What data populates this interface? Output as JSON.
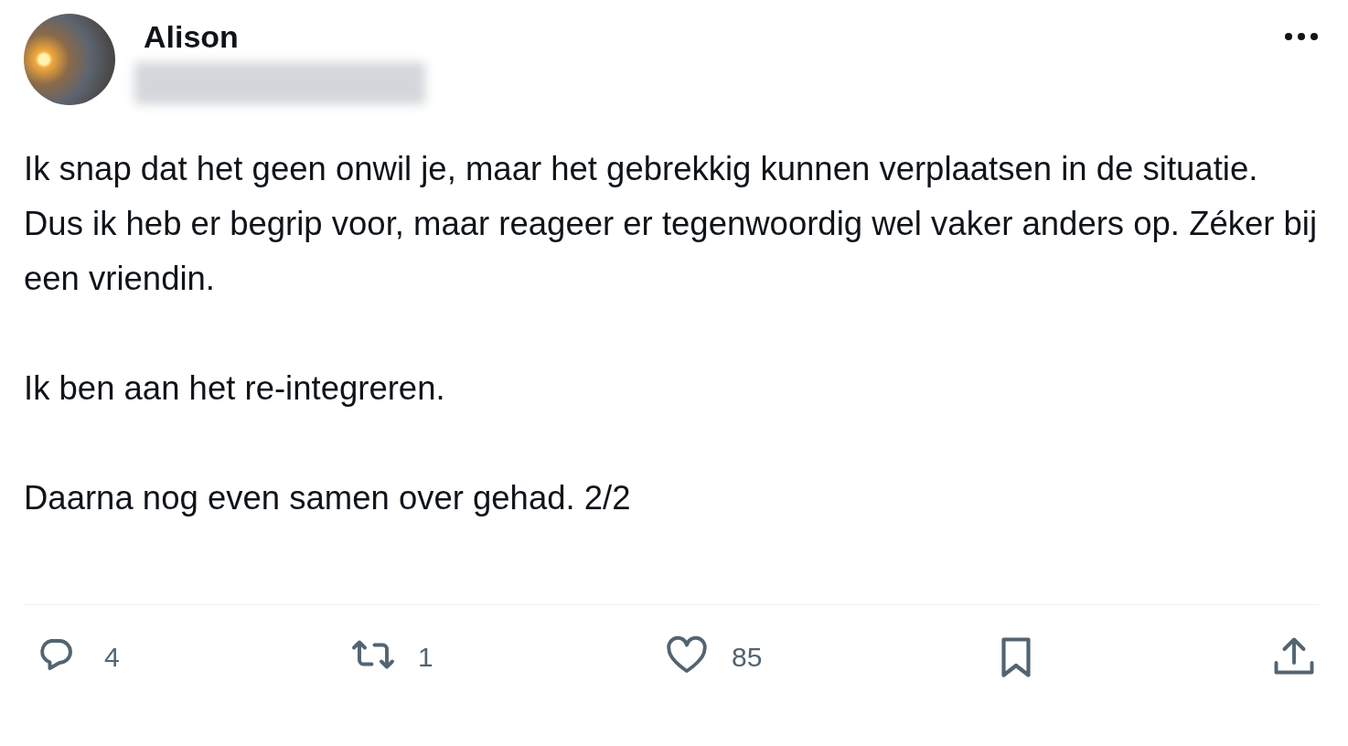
{
  "post": {
    "author": {
      "name": "Alison",
      "handle_redacted": true
    },
    "paragraphs": [
      "Ik snap dat het geen onwil je, maar het gebrekkig kunnen verplaatsen in de situatie. Dus ik heb er begrip voor, maar reageer er tegenwoordig wel vaker anders op. Zéker bij een vriendin.",
      "Ik ben aan het re-integreren.",
      "Daarna nog even samen over gehad. 2/2"
    ],
    "actions": [
      {
        "kind": "reply",
        "count": "4"
      },
      {
        "kind": "repost",
        "count": "1"
      },
      {
        "kind": "like",
        "count": "85"
      },
      {
        "kind": "bookmark"
      },
      {
        "kind": "share"
      }
    ]
  }
}
